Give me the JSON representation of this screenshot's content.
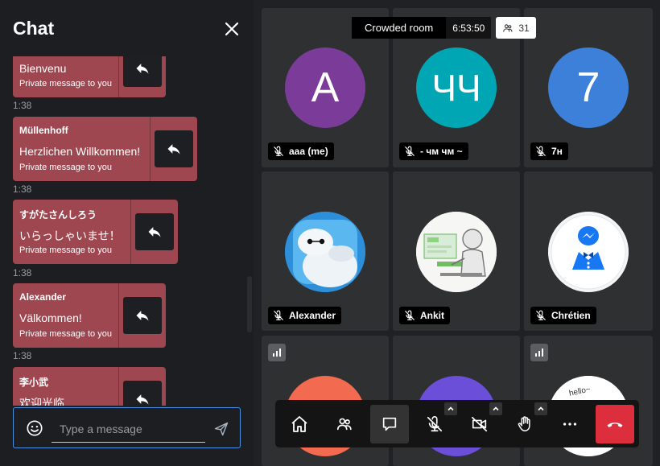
{
  "chat": {
    "title": "Chat",
    "messages": [
      {
        "sender": "",
        "text": "Bienvenu",
        "note": "Private message to you",
        "time": "1:38"
      },
      {
        "sender": "Müllenhoff",
        "text": "Herzlichen Willkommen!",
        "note": "Private message to you",
        "time": "1:38"
      },
      {
        "sender": "すがたさんしろう",
        "text": "いらっしゃいませ！",
        "note": "Private message to you",
        "time": "1:38"
      },
      {
        "sender": "Alexander",
        "text": "Välkommen!",
        "note": "Private message to you",
        "time": "1:38"
      },
      {
        "sender": "李小武",
        "text": "欢迎光临",
        "note": "",
        "time": ""
      }
    ],
    "input_placeholder": "Type a message"
  },
  "room": {
    "name": "Crowded room",
    "timer": "6:53:50",
    "participant_count": "31"
  },
  "tiles": [
    {
      "avatar_text": "A",
      "avatar_color": "#7a3c98",
      "name": "aaa (me)"
    },
    {
      "avatar_text": "ЧЧ",
      "avatar_color": "#00a6b4",
      "name": "- чм чм ~"
    },
    {
      "avatar_text": "7",
      "avatar_color": "#3d80d9",
      "name": "7н"
    },
    {
      "avatar_text": "",
      "avatar_image": "baymax-avatar",
      "name": "Alexander"
    },
    {
      "avatar_text": "",
      "avatar_image": "robot-avatar",
      "name": "Ankit"
    },
    {
      "avatar_text": "",
      "avatar_image": "messenger-bot-avatar",
      "name": "Chrétien"
    },
    {
      "avatar_color": "#f26a4f"
    },
    {
      "avatar_color": "#6b4fd8"
    },
    {
      "avatar_image": "hello-sketch-avatar",
      "avatar_text": "hello~"
    }
  ],
  "toolbar": {
    "buttons": [
      "home-icon",
      "participants-icon",
      "chat-icon",
      "mic-muted-icon",
      "camera-off-icon",
      "raise-hand-icon",
      "more-icon",
      "hangup-icon"
    ],
    "hangup_color": "#dd2e3e"
  },
  "colors": {
    "message_bubble": "#9e4750",
    "composer_border": "#4a90e2"
  }
}
